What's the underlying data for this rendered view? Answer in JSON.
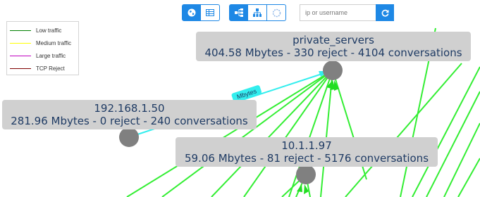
{
  "toolbar": {
    "view_group": [
      {
        "name": "globe-icon",
        "active": true
      },
      {
        "name": "table-icon",
        "active": false
      }
    ],
    "layout_group": [
      {
        "name": "hierarchy-left-icon",
        "active": true
      },
      {
        "name": "sitemap-icon",
        "active": false
      },
      {
        "name": "circle-layout-icon",
        "active": false
      }
    ],
    "search": {
      "placeholder": "ip or username",
      "value": ""
    },
    "refresh_icon": "refresh-icon"
  },
  "legend": {
    "items": [
      {
        "label": "Low traffic",
        "color": "#008000"
      },
      {
        "label": "Medium traffic",
        "color": "#ffff00"
      },
      {
        "label": "Large traffic",
        "color": "#c000c0"
      },
      {
        "label": "TCP Reject",
        "color": "#800000"
      }
    ]
  },
  "nodes": {
    "private_servers": {
      "name": "private_servers",
      "stats": "404.58 Mbytes - 330 reject - 4104 conversations"
    },
    "n192": {
      "name": "192.168.1.50",
      "stats": "281.96 Mbytes - 0 reject - 240 conversations"
    },
    "n10": {
      "name": "10.1.1.97",
      "stats": "59.06 Mbytes - 81 reject - 5176 conversations"
    }
  },
  "edge_label": {
    "text": "Mbytes"
  },
  "colors": {
    "accent": "#1e88e5",
    "node_fill": "#808080",
    "edge_low": "#33ee33",
    "edge_cyan": "#33eeee",
    "label_bg": "#d0d0d0",
    "label_text": "#1f3b64"
  }
}
